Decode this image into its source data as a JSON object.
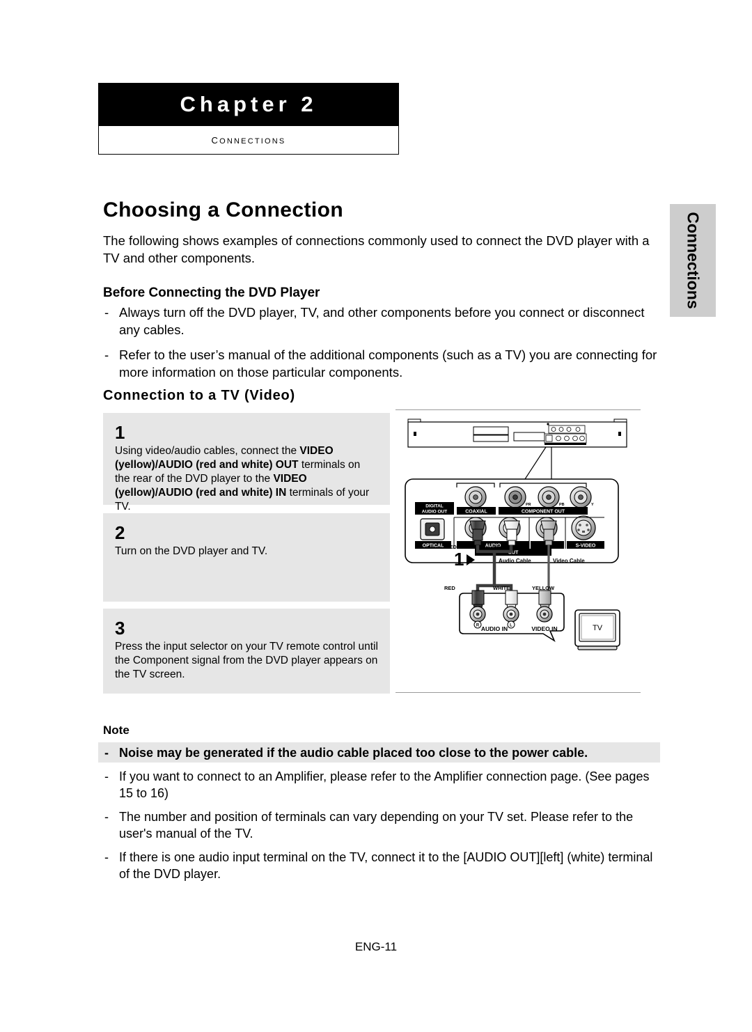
{
  "chapter": {
    "title": "Chapter 2",
    "subtitle": "Connections"
  },
  "side_tab": {
    "label": "Connections"
  },
  "page_title": "Choosing a Connection",
  "intro": "The following shows examples of connections commonly used to connect the DVD player with a TV and other components.",
  "before_connecting": {
    "heading": "Before Connecting the DVD Player",
    "dash": "-",
    "items": [
      "Always turn off the DVD player, TV, and other components before you connect or disconnect any cables.",
      "Refer to the user’s manual of the additional components (such as a TV) you are connecting for more information on those particular components."
    ]
  },
  "connection_section": {
    "heading": "Connection to a TV (Video)",
    "steps": [
      {
        "number": "1",
        "parts": [
          {
            "text": "Using video/audio cables, connect the ",
            "bold": false
          },
          {
            "text": "VIDEO (yellow)/AUDIO (red and white) OUT",
            "bold": true
          },
          {
            "text": " terminals on the rear of the DVD player to the ",
            "bold": false
          },
          {
            "text": "VIDEO (yellow)/AUDIO (red and white) IN",
            "bold": true
          },
          {
            "text": " terminals of your TV.",
            "bold": false
          }
        ]
      },
      {
        "number": "2",
        "parts": [
          {
            "text": "Turn on the DVD player and TV.",
            "bold": false
          }
        ]
      },
      {
        "number": "3",
        "parts": [
          {
            "text": "Press the input selector on your TV remote control until the Component signal from the DVD player appears on the TV screen.",
            "bold": false
          }
        ]
      }
    ]
  },
  "diagram": {
    "step_marker": "1",
    "rear_panel_labels": {
      "digital_audio_out": "DIGITAL\nAUDIO OUT",
      "coaxial": "COAXIAL",
      "component_out": "COMPONENT OUT",
      "optical": "OPTICAL",
      "audio": "AUDIO",
      "out": "OUT",
      "s_video": "S-VIDEO",
      "component_jacks": [
        "PR",
        "PB",
        "Y"
      ]
    },
    "cable_labels": {
      "audio_cable": "Audio Cable",
      "video_cable": "Video Cable"
    },
    "connector_colors_top": [
      "RED",
      "WHITE",
      "YELLOW"
    ],
    "connector_colors_bottom": [
      "RED",
      "WHITE",
      "YELLOW"
    ],
    "tv_panel": {
      "audio_in": "AUDIO IN",
      "video_in": "VIDEO IN",
      "right_channel": "R",
      "left_channel": "L",
      "tv_label": "TV"
    },
    "colors": {
      "red_plug": "#4d4d4d",
      "white_plug": "#ffffff",
      "yellow_plug": "#bfbfbf",
      "metal": "#b3b3b3",
      "panel_black": "#000000"
    }
  },
  "note": {
    "heading": "Note",
    "dash": "-",
    "items": [
      {
        "text": "Noise may be generated if the audio cable placed too close to the power cable.",
        "bold": true
      },
      {
        "text": "If you want to connect to an Amplifier, please refer to the Amplifier connection page. (See pages 15 to 16)",
        "bold": false
      },
      {
        "text": "The number and position of terminals can vary depending on your TV set. Please refer to the user's manual of the TV.",
        "bold": false
      },
      {
        "text": "If there is one audio input terminal on the TV, connect it to the [AUDIO OUT][left] (white) terminal of the DVD player.",
        "bold": false
      }
    ]
  },
  "footer": "ENG-11"
}
